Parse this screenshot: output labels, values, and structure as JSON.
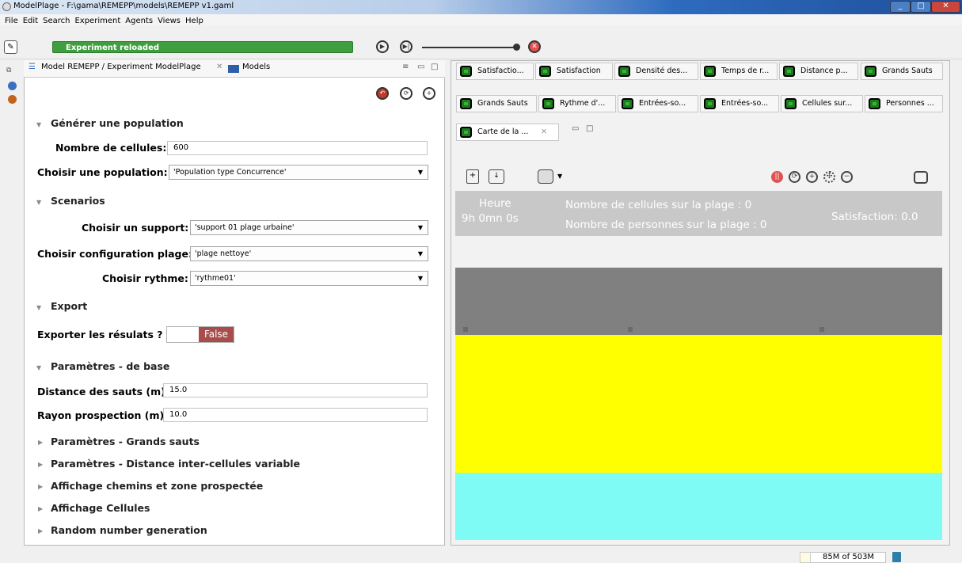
{
  "window": {
    "title": "ModelPlage - F:\\gama\\REMEPP\\models\\REMEPP v1.gaml"
  },
  "menu": [
    "File",
    "Edit",
    "Search",
    "Experiment",
    "Agents",
    "Views",
    "Help"
  ],
  "toolbar": {
    "status": "Experiment reloaded"
  },
  "left_panel": {
    "tabs": [
      {
        "label": "Model REMEPP / Experiment ModelPlage"
      },
      {
        "label": "Models"
      }
    ],
    "sections": {
      "generate": "Générer une population",
      "scenarios": "Scenarios",
      "export": "Export",
      "base_params": "Paramètres - de base",
      "grands_sauts": "Paramètres - Grands sauts",
      "distance_var": "Paramètres - Distance inter-cellules variable",
      "affichage_chemins": "Affichage chemins et zone prospectée",
      "affichage_cellules": "Affichage Cellules",
      "random": "Random number generation"
    },
    "params": {
      "nb_cells_label": "Nombre de cellules:",
      "nb_cells_value": "600",
      "population_label": "Choisir une population:",
      "population_value": "'Population type Concurrence'",
      "support_label": "Choisir un support:",
      "support_value": "'support 01 plage urbaine'",
      "config_label": "Choisir configuration plage:",
      "config_value": "'plage nettoye'",
      "rythme_label": "Choisir rythme:",
      "rythme_value": "'rythme01'",
      "export_label": "Exporter les résulats ?",
      "export_value": "False",
      "distance_label": "Distance des sauts (m)",
      "distance_value": "15.0",
      "rayon_label": "Rayon prospection (m)",
      "rayon_value": "10.0"
    }
  },
  "right_panel": {
    "tabs_row1": [
      "Satisfactio...",
      "Satisfaction",
      "Densité des...",
      "Temps de r...",
      "Distance p...",
      "Grands Sauts"
    ],
    "tabs_row2": [
      "Grands Sauts",
      "Rythme d'...",
      "Entrées-so...",
      "Entrées-so...",
      "Cellules sur...",
      "Personnes ..."
    ],
    "tabs_row3": [
      "Carte de la ..."
    ],
    "display": {
      "heure_label": "Heure",
      "heure_value": "9h 0mn 0s",
      "cells_text": "Nombre de cellules sur la plage : 0",
      "persons_text": "Nombre de personnes sur la plage : 0",
      "satisfaction_text": "Satisfaction: 0.0"
    },
    "map_colors": {
      "land": "#808080",
      "beach": "#ffff00",
      "sea": "#7ffbf5"
    }
  },
  "status_bar": {
    "memory": "85M of 503M"
  }
}
